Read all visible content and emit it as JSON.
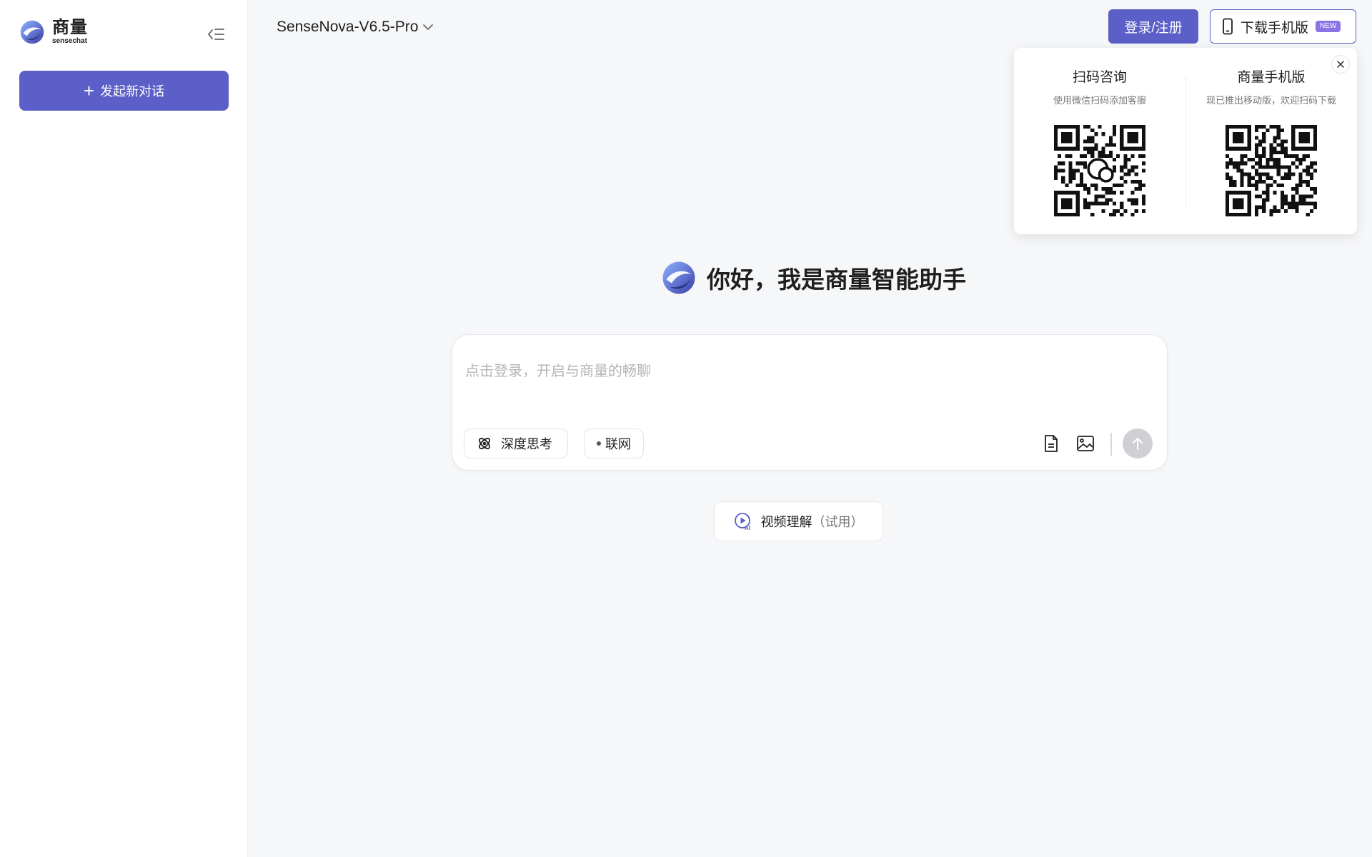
{
  "sidebar": {
    "brand_cn": "商量",
    "brand_en": "sensechat",
    "new_chat_label": "发起新对话"
  },
  "header": {
    "model_name": "SenseNova-V6.5-Pro",
    "login_label": "登录/注册",
    "download_label": "下载手机版",
    "download_badge": "NEW"
  },
  "qr_popup": {
    "left_title": "扫码咨询",
    "left_subtitle": "使用微信扫码添加客服",
    "right_title": "商量手机版",
    "right_subtitle": "现已推出移动版，欢迎扫码下载"
  },
  "main": {
    "greeting": "你好，我是商量智能助手",
    "input_placeholder": "点击登录，开启与商量的畅聊",
    "deep_think_label": "深度思考",
    "web_label": "联网",
    "video_label": "视频理解",
    "video_trial": "（试用）"
  },
  "colors": {
    "accent": "#5b5fc7",
    "badge": "#8a73e6",
    "send_disabled": "#cfd0d4"
  },
  "icons": {
    "collapse": "collapse-sidebar-icon",
    "phone": "phone-icon",
    "close": "close-icon",
    "deep_think": "deep-think-icon",
    "file": "file-icon",
    "image": "image-icon",
    "send": "arrow-up-icon",
    "video": "video-ai-icon"
  }
}
